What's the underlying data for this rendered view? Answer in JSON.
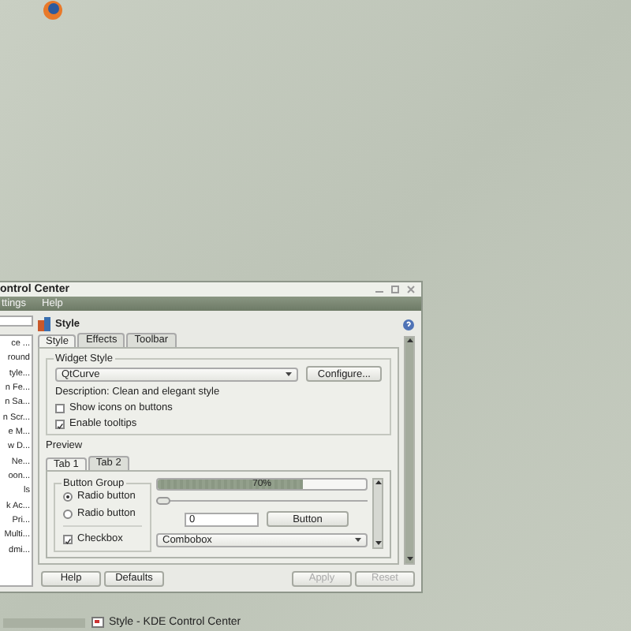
{
  "window": {
    "title": "ontrol Center",
    "menu": [
      "ttings",
      "Help"
    ]
  },
  "sidebar": {
    "items": [
      {
        "label": "ce ...",
        "selected": false
      },
      {
        "label": "round",
        "selected": false
      },
      {
        "label": "tyle...",
        "selected": false
      },
      {
        "label": "n Fe...",
        "selected": false
      },
      {
        "label": "n Sa...",
        "selected": false
      },
      {
        "label": "n Scr...",
        "selected": false
      },
      {
        "label": "e M...",
        "selected": false
      },
      {
        "label": "w D...",
        "selected": false
      },
      {
        "label": "Ne...",
        "selected": false
      },
      {
        "label": "oon...",
        "selected": false
      },
      {
        "label": "ls",
        "selected": false
      },
      {
        "label": "k Ac...",
        "selected": false
      },
      {
        "label": "Pri...",
        "selected": false
      },
      {
        "label": "Multi...",
        "selected": false
      },
      {
        "label": "dmi...",
        "selected": false
      }
    ]
  },
  "page": {
    "title": "Style",
    "tabs": [
      {
        "label": "Style",
        "selected": true
      },
      {
        "label": "Effects",
        "selected": false
      },
      {
        "label": "Toolbar",
        "selected": false
      }
    ],
    "widget_style": {
      "title": "Widget Style",
      "value": "QtCurve",
      "configure": "Configure...",
      "description": "Description: Clean and elegant style",
      "options": [
        {
          "label": "Show icons on buttons",
          "checked": false
        },
        {
          "label": "Enable tooltips",
          "checked": true
        }
      ]
    },
    "preview": {
      "title": "Preview",
      "tabs": [
        {
          "label": "Tab 1",
          "selected": true
        },
        {
          "label": "Tab 2",
          "selected": false
        }
      ],
      "button_group": {
        "title": "Button Group",
        "radios": [
          {
            "label": "Radio button",
            "selected": true
          },
          {
            "label": "Radio button",
            "selected": false
          }
        ],
        "checkbox": {
          "label": "Checkbox",
          "checked": true
        }
      },
      "progress": {
        "level": 0.7,
        "reading": "70%"
      },
      "slider": {
        "level": 0
      },
      "spinbox": {
        "value": "0"
      },
      "button": "Button",
      "combobox": "Combobox"
    }
  },
  "left_buttons": [
    {
      "label": "Help",
      "disabled": false
    },
    {
      "label": "Defaults",
      "disabled": false
    }
  ],
  "right_buttons": [
    {
      "label": "Apply",
      "disabled": true
    },
    {
      "label": "Reset",
      "disabled": true
    }
  ],
  "taskbar": {
    "task": "Style - KDE Control Center"
  }
}
